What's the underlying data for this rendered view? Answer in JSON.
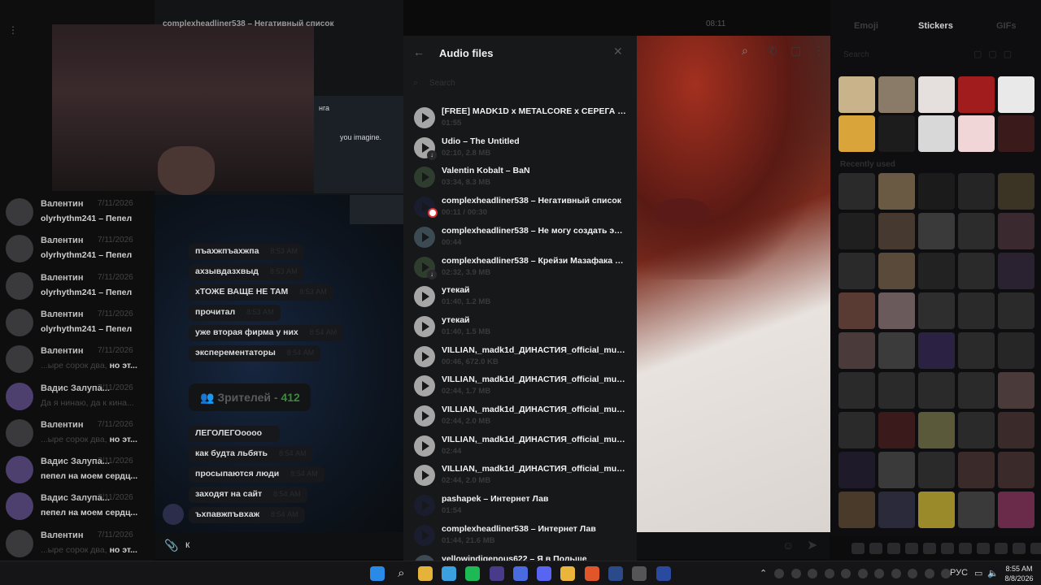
{
  "window": {
    "header_title": "complexheadliner538 – Негативный список",
    "header_time": "08:11",
    "menu_icon": "menu-dots-icon"
  },
  "chat_list": [
    {
      "name": "Валентин",
      "date": "7/11/2026",
      "prefix": "",
      "preview": "olyrhythm241 – Пепел",
      "dim": "",
      "avatar": "grey"
    },
    {
      "name": "Валентин",
      "date": "7/11/2026",
      "prefix": "",
      "preview": "olyrhythm241 – Пепел",
      "dim": "",
      "avatar": "grey"
    },
    {
      "name": "Валентин",
      "date": "7/11/2026",
      "prefix": "",
      "preview": "olyrhythm241 – Пепел",
      "dim": "",
      "avatar": "grey"
    },
    {
      "name": "Валентин",
      "date": "7/11/2026",
      "prefix": "",
      "preview": "olyrhythm241 – Пепел",
      "dim": "",
      "avatar": "grey"
    },
    {
      "name": "Валентин",
      "date": "7/11/2026",
      "prefix": "",
      "preview": "но эт...",
      "dim": "...ыре сорок два, ",
      "avatar": "grey"
    },
    {
      "name": "Вадис Залупа...",
      "date": "7/11/2026",
      "prefix": "",
      "preview": "",
      "dim": "Да я нинаю, да к кина...",
      "avatar": "purple"
    },
    {
      "name": "Валентин",
      "date": "7/11/2026",
      "prefix": "",
      "preview": "но эт...",
      "dim": "...ыре сорок два, ",
      "avatar": "grey"
    },
    {
      "name": "Вадис Залупа...",
      "date": "7/11/2026",
      "prefix": "",
      "preview": "пепел на моем сердц...",
      "dim": "",
      "avatar": "purple"
    },
    {
      "name": "Вадис Залупа...",
      "date": "7/11/2026",
      "prefix": "",
      "preview": "пепел на моем сердц...",
      "dim": "",
      "avatar": "purple"
    },
    {
      "name": "Валентин",
      "date": "7/11/2026",
      "prefix": "",
      "preview": "но эт...",
      "dim": "...ыре сорок два, ",
      "avatar": "grey"
    }
  ],
  "stream": {
    "screen_tag": "нга",
    "screen_text": "you imagine.",
    "messages": [
      {
        "text": "пъахжпъахжпа",
        "time": "8:53 AM"
      },
      {
        "text": "ахзывдазхвыд",
        "time": "8:53 AM"
      },
      {
        "text": "хТОЖЕ ВАЩЕ НЕ ТАМ",
        "time": "8:53 AM"
      },
      {
        "text": "прочитал",
        "time": "8:53 AM"
      },
      {
        "text": "уже вторая фирма у них",
        "time": "8:54 AM"
      },
      {
        "text": "эксперементаторы",
        "time": "8:54 AM"
      }
    ],
    "viewers_label": "Зрителей - ",
    "viewers_count": "412",
    "messages2": [
      {
        "text": "ЛЕГОЛЕГОoooo",
        "time": ""
      },
      {
        "text": "как будта льбять",
        "time": "8:54 AM"
      },
      {
        "text": "просыпаются люди",
        "time": "8:54 AM"
      },
      {
        "text": "заходят на сайт",
        "time": "8:54 AM"
      },
      {
        "text": "ъхпавжпъвхаж",
        "time": "8:54 AM"
      }
    ]
  },
  "input": {
    "value": "к"
  },
  "audio_modal": {
    "title": "Audio files",
    "search_placeholder": "Search",
    "tracks": [
      {
        "title": "[FREE] MADK1D x METALCORE x СЕРЕГА ПИРАТ",
        "meta": "01:55",
        "style": "plain",
        "badge": ""
      },
      {
        "title": "Udio – The Untitled",
        "meta": "02:10, 2.8 MB",
        "style": "plain",
        "badge": "download"
      },
      {
        "title": "Valentin Kobalt – BaN",
        "meta": "03:34, 8.3 MB",
        "style": "cover2",
        "badge": ""
      },
      {
        "title": "complexheadliner538 – Негативный список",
        "meta": "00:11 / 00:30",
        "style": "dark",
        "badge": "pink"
      },
      {
        "title": "complexheadliner538 – Не могу создать эмоции",
        "meta": "00:44",
        "style": "cover",
        "badge": ""
      },
      {
        "title": "complexheadliner538 – Крейзи Мазафака Белый",
        "meta": "02:32, 3.9 MB",
        "style": "cover2",
        "badge": "download"
      },
      {
        "title": "утекай",
        "meta": "01:40, 1.2 MB",
        "style": "plain",
        "badge": ""
      },
      {
        "title": "утекай",
        "meta": "01:40, 1.5 MB",
        "style": "plain",
        "badge": ""
      },
      {
        "title": "VILLIAN,_madk1d_ДИНАСТИЯ_official_music",
        "meta": "00:46, 672.0 KB",
        "style": "plain",
        "badge": ""
      },
      {
        "title": "VILLIAN,_madk1d_ДИНАСТИЯ_official_music",
        "meta": "02:44, 1.7 MB",
        "style": "plain",
        "badge": ""
      },
      {
        "title": "VILLIAN,_madk1d_ДИНАСТИЯ_official_music",
        "meta": "02:44, 2.0 MB",
        "style": "plain",
        "badge": ""
      },
      {
        "title": "VILLIAN,_madk1d_ДИНАСТИЯ_official_music",
        "meta": "02:44",
        "style": "plain",
        "badge": ""
      },
      {
        "title": "VILLIAN,_madk1d_ДИНАСТИЯ_official_music",
        "meta": "02:44, 2.0 MB",
        "style": "plain",
        "badge": ""
      },
      {
        "title": "pashapek – Интернет Лав",
        "meta": "01:54",
        "style": "dark",
        "badge": ""
      },
      {
        "title": "complexheadliner538 – Интернет Лав",
        "meta": "01:44, 21.6 MB",
        "style": "dark",
        "badge": ""
      },
      {
        "title": "yellowindigenous622 – Я в Польше",
        "meta": "",
        "style": "cover",
        "badge": ""
      }
    ]
  },
  "stickers_panel": {
    "tabs": [
      "Emoji",
      "Stickers",
      "GIFs"
    ],
    "active_tab": "Stickers",
    "search_placeholder": "Search",
    "recent_label": "Recently used"
  },
  "taskbar": {
    "lang": "РУС",
    "time": "8:55 AM",
    "date": "8/8/2026",
    "apps": [
      "windows-start-icon",
      "search-icon",
      "file-explorer-icon",
      "app-icon",
      "spotify-icon",
      "telegram-icon",
      "app-icon",
      "discord-icon",
      "chrome-icon",
      "brave-icon",
      "steam-icon",
      "app-icon",
      "terminal-icon"
    ]
  },
  "colors": {
    "accent_green": "#3a8a3a",
    "modal_bg": "#17181a"
  }
}
